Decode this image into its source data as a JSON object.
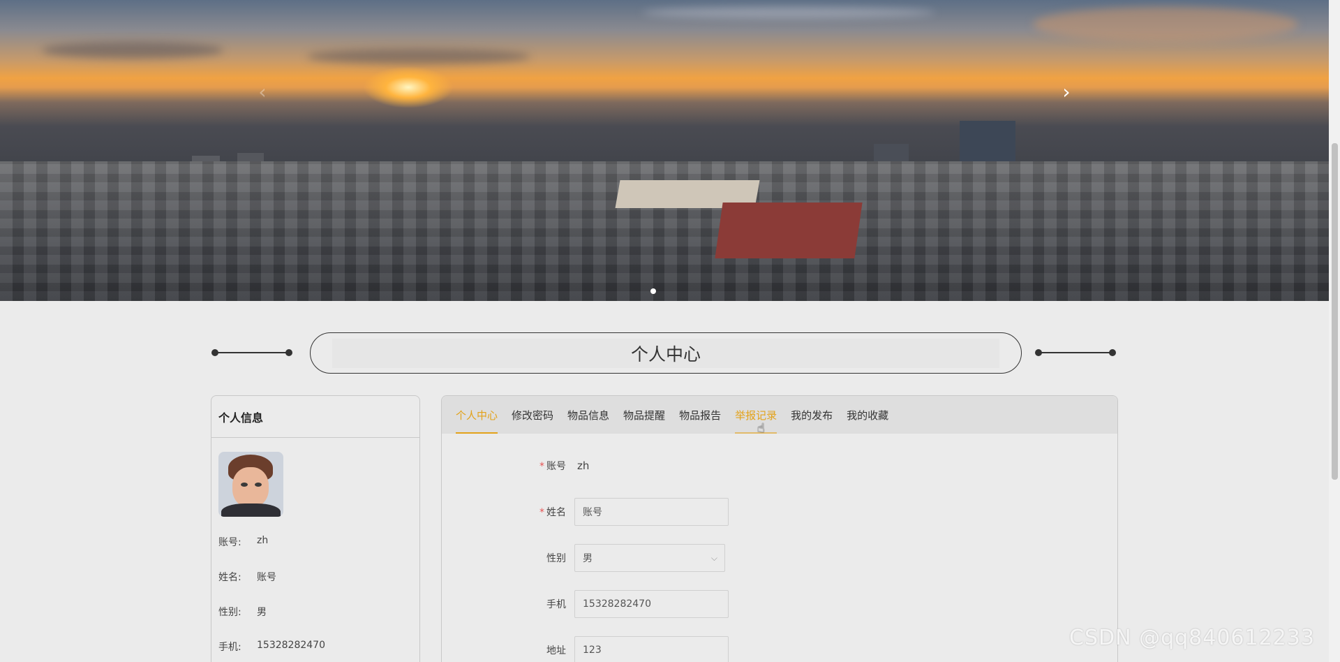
{
  "banner": {
    "prev_arrow": "‹",
    "next_arrow": "›"
  },
  "page": {
    "title": "个人中心"
  },
  "profile": {
    "heading": "个人信息",
    "rows": [
      {
        "label": "账号:",
        "value": "zh"
      },
      {
        "label": "姓名:",
        "value": "账号"
      },
      {
        "label": "性别:",
        "value": "男"
      },
      {
        "label": "手机:",
        "value": "15328282470"
      }
    ]
  },
  "tabs": [
    {
      "label": "个人中心",
      "state": "active"
    },
    {
      "label": "修改密码",
      "state": ""
    },
    {
      "label": "物品信息",
      "state": ""
    },
    {
      "label": "物品提醒",
      "state": ""
    },
    {
      "label": "物品报告",
      "state": ""
    },
    {
      "label": "举报记录",
      "state": "hover"
    },
    {
      "label": "我的发布",
      "state": ""
    },
    {
      "label": "我的收藏",
      "state": ""
    }
  ],
  "form": {
    "account": {
      "label": "账号",
      "required": true,
      "value": "zh"
    },
    "name": {
      "label": "姓名",
      "required": true,
      "value": "账号"
    },
    "gender": {
      "label": "性别",
      "required": false,
      "value": "男"
    },
    "phone": {
      "label": "手机",
      "required": false,
      "value": "15328282470"
    },
    "next_label_partial": "地址",
    "next_value_partial": "123"
  },
  "colors": {
    "accent": "#e3a21a",
    "required": "#e55454",
    "background": "#ebebeb"
  },
  "watermark": "CSDN @qq840612233"
}
